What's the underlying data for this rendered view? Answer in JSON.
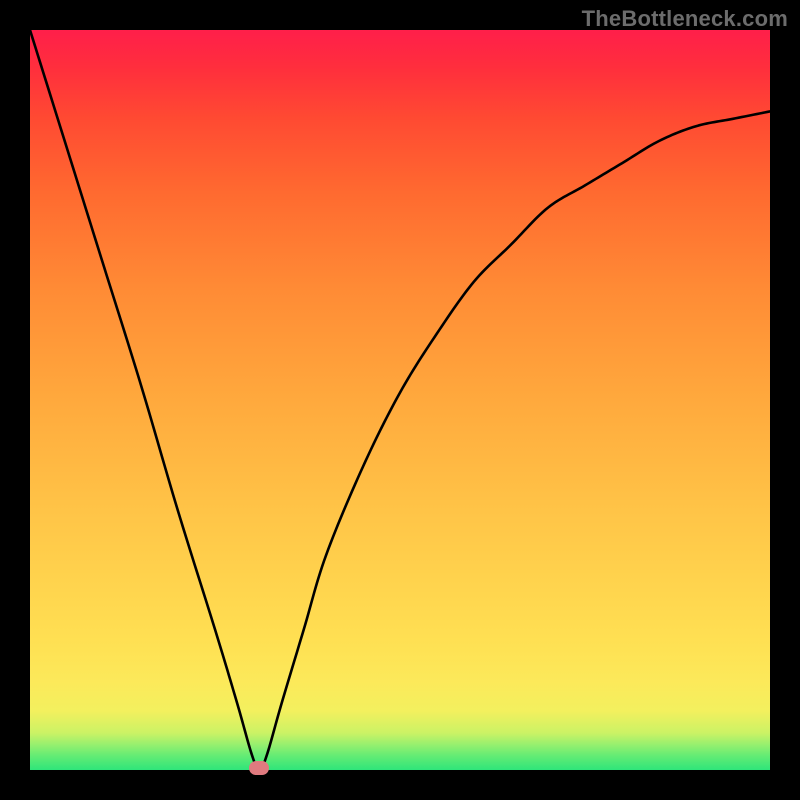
{
  "watermark": "TheBottleneck.com",
  "chart_data": {
    "type": "line",
    "title": "",
    "xlabel": "",
    "ylabel": "",
    "xlim": [
      0,
      1
    ],
    "ylim": [
      0,
      1
    ],
    "series": [
      {
        "name": "bottleneck-curve",
        "x": [
          0.0,
          0.05,
          0.1,
          0.15,
          0.2,
          0.25,
          0.28,
          0.3,
          0.31,
          0.32,
          0.34,
          0.37,
          0.4,
          0.45,
          0.5,
          0.55,
          0.6,
          0.65,
          0.7,
          0.75,
          0.8,
          0.85,
          0.9,
          0.95,
          1.0
        ],
        "y": [
          1.0,
          0.84,
          0.68,
          0.52,
          0.35,
          0.19,
          0.09,
          0.02,
          0.0,
          0.02,
          0.09,
          0.19,
          0.29,
          0.41,
          0.51,
          0.59,
          0.66,
          0.71,
          0.76,
          0.79,
          0.82,
          0.85,
          0.87,
          0.88,
          0.89
        ]
      }
    ],
    "marker": {
      "x": 0.31,
      "y": 0.0
    },
    "colors": {
      "gradient_top": "#ff1f4a",
      "gradient_bottom": "#2ee57a",
      "curve": "#000000",
      "marker": "#e07a7f",
      "frame": "#000000"
    }
  }
}
